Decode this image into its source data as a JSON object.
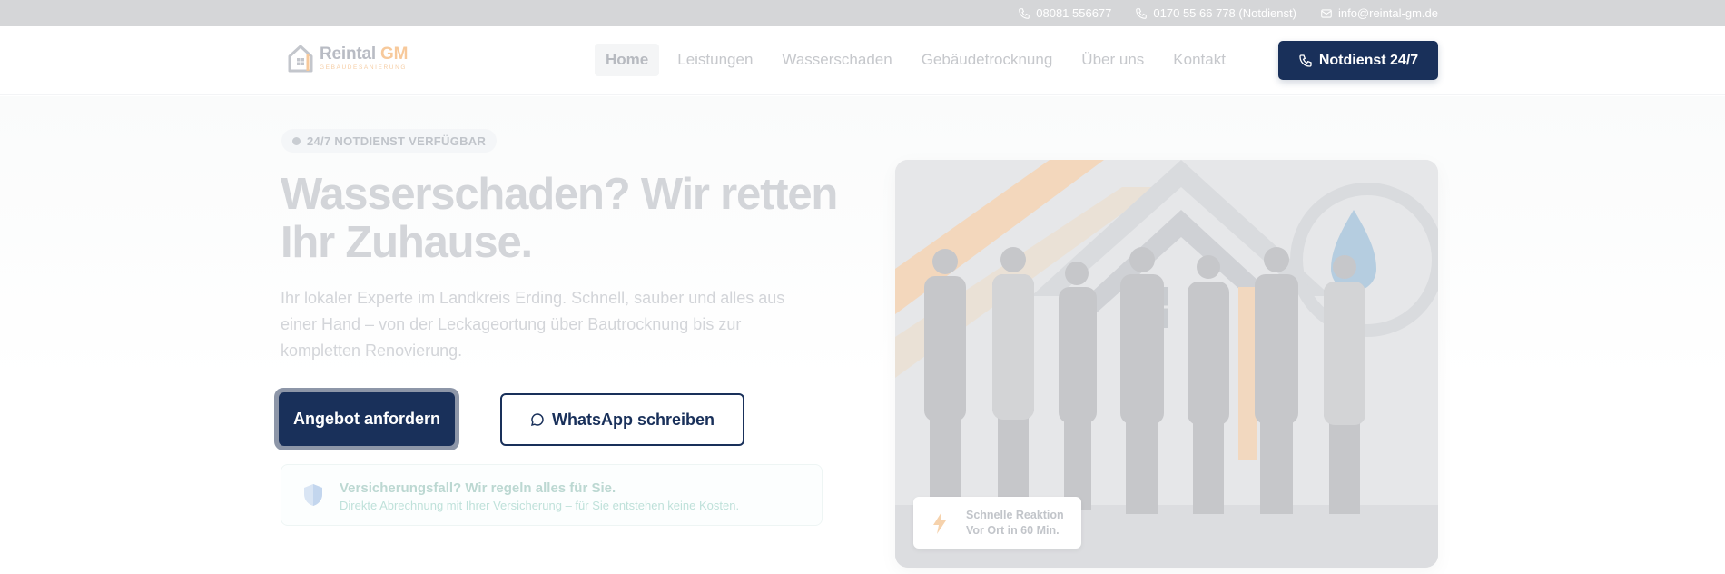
{
  "topbar": {
    "phone": "08081 556677",
    "emergency_phone": "0170 55 66 778 (Notdienst)",
    "email": "info@reintal-gm.de"
  },
  "logo": {
    "name": "Reintal",
    "name_accent": "GM",
    "subtitle": "GEBÄUDESANIERUNG"
  },
  "nav": {
    "items": [
      {
        "label": "Home",
        "active": true
      },
      {
        "label": "Leistungen",
        "active": false
      },
      {
        "label": "Wasserschaden",
        "active": false
      },
      {
        "label": "Gebäudetrocknung",
        "active": false
      },
      {
        "label": "Über uns",
        "active": false
      },
      {
        "label": "Kontakt",
        "active": false
      }
    ],
    "cta_label": "Notdienst 24/7"
  },
  "hero": {
    "badge": "24/7 NOTDIENST VERFÜGBAR",
    "title": "Wasserschaden? Wir retten Ihr Zuhause.",
    "text": "Ihr lokaler Experte im Landkreis Erding. Schnell, sauber und alles aus einer Hand – von der Leckageortung über Bautrocknung bis zur kompletten Renovierung.",
    "primary_button": "Angebot anfordern",
    "secondary_button": "WhatsApp schreiben",
    "insurance_title": "Versicherungsfall? Wir regeln alles für Sie.",
    "insurance_text": "Direkte Abrechnung mit Ihrer Versicherung – für Sie entstehen keine Kosten."
  },
  "quick_card": {
    "line1": "Schnelle Reaktion",
    "line2": "Vor Ort in 60 Min."
  },
  "colors": {
    "primary": "#19305a",
    "accent_orange": "#f0a25a",
    "accent_teal": "#7cc4b5"
  },
  "icons": {
    "phone": "phone-icon",
    "mail": "mail-icon",
    "whatsapp": "chat-bubble-icon",
    "shield": "shield-icon",
    "lightning": "lightning-icon"
  }
}
